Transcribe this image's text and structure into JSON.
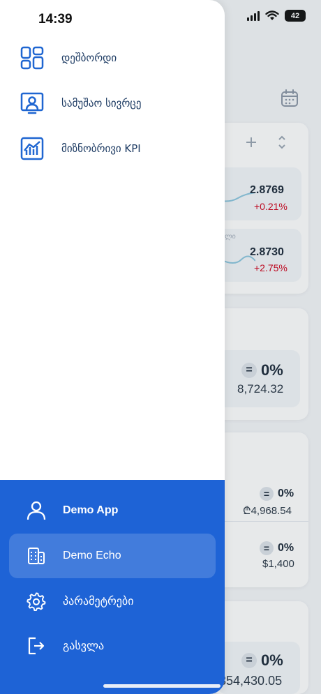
{
  "status": {
    "time": "14:39",
    "battery": "42"
  },
  "menu": {
    "items": [
      {
        "label": "დეშბორდი",
        "icon": "dashboard-grid-icon"
      },
      {
        "label": "სამუშაო სივრცე",
        "icon": "workspace-presentation-icon"
      },
      {
        "label": "მიზნობრივი KPI",
        "icon": "kpi-chart-icon"
      }
    ]
  },
  "account": {
    "user_name": "Demo App",
    "company": "Demo Echo",
    "settings": "პარამეტრები",
    "logout": "გასვლა"
  },
  "background": {
    "rate1": {
      "value": "2.8769",
      "change": "+0.21%"
    },
    "rate2": {
      "value": "2.8730",
      "change": "+2.75%"
    },
    "balance_main": {
      "eq": "=",
      "percent": "0%",
      "amount": "8,724.32"
    },
    "balance_gel": {
      "eq": "=",
      "percent": "0%",
      "amount": "₾4,968.54"
    },
    "balance_usd": {
      "eq": "=",
      "percent": "0%",
      "amount": "$1,400"
    },
    "balance_total": {
      "eq": "=",
      "percent": "0%",
      "amount": "354,430.05"
    },
    "partial_label": "ლი"
  },
  "colors": {
    "drawer_accent": "#1e63d6",
    "icon_blue": "#1f66d1",
    "negative": "#d0021b"
  }
}
